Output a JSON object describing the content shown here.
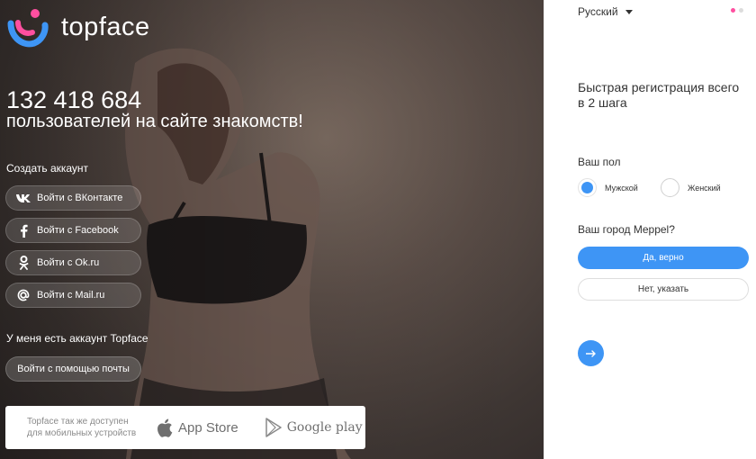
{
  "brand": {
    "name": "topface"
  },
  "hero": {
    "users_count": "132 418 684",
    "users_subtitle": "пользователей на сайте знакомств!",
    "create_account_title": "Создать аккаунт",
    "social_buttons": [
      {
        "label": "Войти с ВКонтакте",
        "icon": "vk-icon"
      },
      {
        "label": "Войти с Facebook",
        "icon": "facebook-icon"
      },
      {
        "label": "Войти с Ok.ru",
        "icon": "odnoklassniki-icon"
      },
      {
        "label": "Войти с Mail.ru",
        "icon": "mailru-icon"
      }
    ],
    "have_account_title": "У меня есть аккаунт Topface",
    "email_login_label": "Войти с помощью почты",
    "stores_text": "Topface так же доступен для мобильных устройств",
    "app_store_label": "App Store",
    "google_play_label": "Google play"
  },
  "panel": {
    "language": "Русский",
    "steps_colors": [
      "#ff4fa0",
      "#dcdcdc"
    ],
    "registration_title": "Быстрая регистрация всего в 2 шага",
    "gender_label": "Ваш пол",
    "gender_options": [
      {
        "label": "Мужской",
        "selected": true
      },
      {
        "label": "Женский",
        "selected": false
      }
    ],
    "city_question": "Ваш город Meppel?",
    "confirm_label": "Да, верно",
    "decline_label": "Нет, указать",
    "next_icon": "arrow-right-icon"
  },
  "colors": {
    "accent": "#3e95f5",
    "brand_pink": "#ff4fa0",
    "brand_blue": "#3e95f5"
  }
}
